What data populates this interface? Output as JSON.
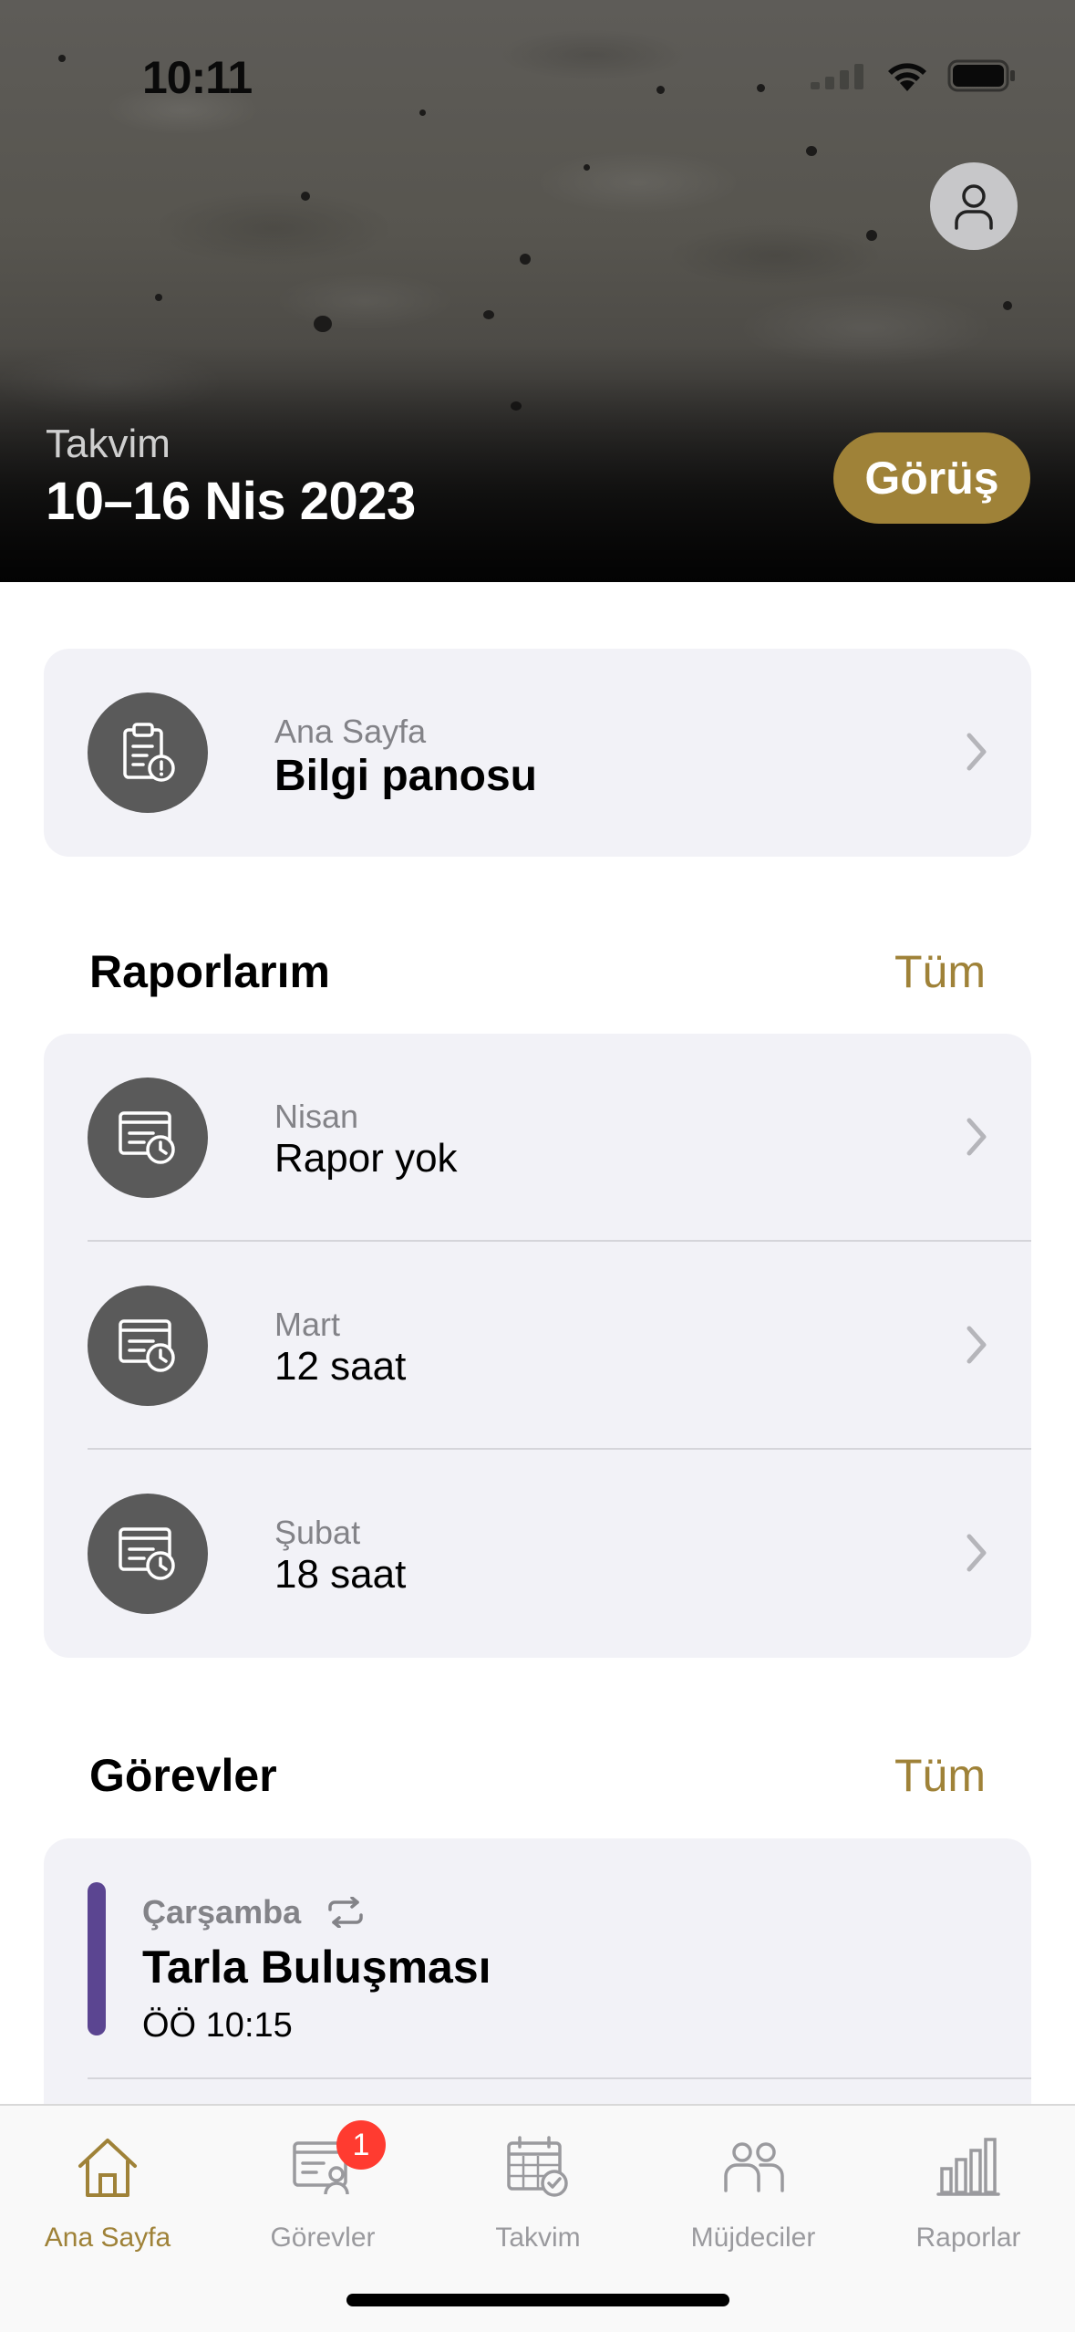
{
  "status_bar": {
    "time": "10:11"
  },
  "header": {
    "calendar_label": "Takvim",
    "date_range": "10–16 Nis 2023",
    "view_button": "Görüş",
    "profile_icon": "person-icon"
  },
  "dashboard": {
    "subtitle": "Ana Sayfa",
    "title": "Bilgi panosu",
    "icon": "clipboard-alert-icon"
  },
  "reports": {
    "section_title": "Raporlarım",
    "all_link": "Tüm",
    "items": [
      {
        "month": "Nisan",
        "value": "Rapor yok"
      },
      {
        "month": "Mart",
        "value": "12 saat"
      },
      {
        "month": "Şubat",
        "value": "18 saat"
      }
    ]
  },
  "tasks": {
    "section_title": "Görevler",
    "all_link": "Tüm",
    "items": [
      {
        "day": "Çarşamba",
        "title": "Tarla Buluşması",
        "time": "ÖÖ 10:15",
        "color": "#5b4591",
        "repeat_icon": "repeat-icon"
      }
    ]
  },
  "tabbar": {
    "tabs": [
      {
        "label": "Ana Sayfa",
        "icon": "home-icon",
        "active": true
      },
      {
        "label": "Görevler",
        "icon": "tasks-icon",
        "badge": "1"
      },
      {
        "label": "Takvim",
        "icon": "calendar-check-icon"
      },
      {
        "label": "Müjdeciler",
        "icon": "people-icon"
      },
      {
        "label": "Raporlar",
        "icon": "bar-chart-icon"
      }
    ]
  },
  "colors": {
    "accent": "#9f8238",
    "badge": "#ff3b30",
    "card_bg": "#f2f2f7",
    "icon_circle": "#5a5a5a"
  }
}
